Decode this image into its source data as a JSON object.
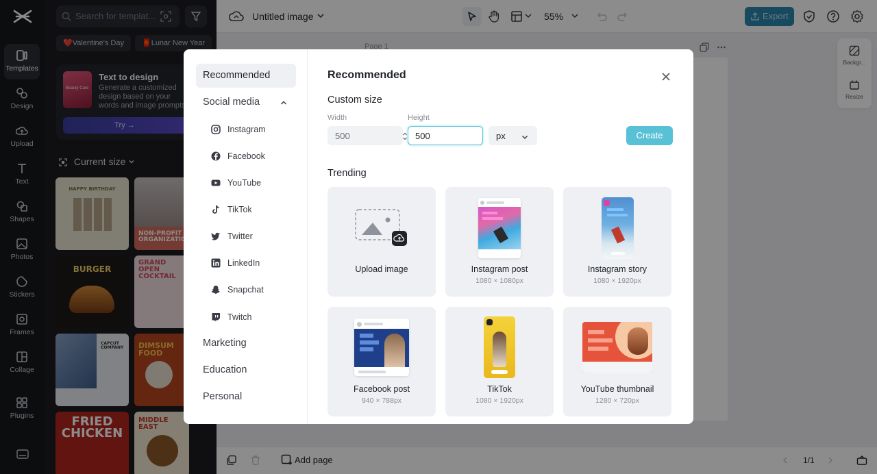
{
  "rail": {
    "items": [
      {
        "label": "Templates"
      },
      {
        "label": "Design"
      },
      {
        "label": "Upload"
      },
      {
        "label": "Text"
      },
      {
        "label": "Shapes"
      },
      {
        "label": "Photos"
      },
      {
        "label": "Stickers"
      },
      {
        "label": "Frames"
      },
      {
        "label": "Collage"
      },
      {
        "label": "Plugins"
      }
    ]
  },
  "panel": {
    "search_placeholder": "Search for templat...",
    "chips": [
      "❤️Valentine's Day",
      "🧧Lunar New Year"
    ],
    "text_to_design": {
      "thumb_text": "Beauty Care",
      "title": "Text to design",
      "desc": "Generate a customized design based on your words and image prompts.",
      "try_label": "Try →"
    },
    "current_size": "Current size",
    "templates": [
      {
        "text": "HAPPY BIRTHDAY"
      },
      {
        "text": "NON-PROFIT ORGANIZATION"
      },
      {
        "text": "BURGER"
      },
      {
        "text": "GRAND OPEN COCKTAIL"
      },
      {
        "text": "CAPCUT COMPANY"
      },
      {
        "text": "DIMSUM FOOD"
      },
      {
        "text": "FRIED CHICKEN"
      },
      {
        "text": "MIDDLE EAST"
      }
    ]
  },
  "topbar": {
    "title": "Untitled image",
    "zoom": "55%",
    "export_label": "Export"
  },
  "canvas": {
    "page_label": "Page 1",
    "side_tools": [
      "Backgr...",
      "Resize"
    ]
  },
  "bottombar": {
    "add_page": "Add page",
    "pager": "1/1"
  },
  "modal": {
    "nav": {
      "recommended": "Recommended",
      "social_media": "Social media",
      "social_items": [
        "Instagram",
        "Facebook",
        "YouTube",
        "TikTok",
        "Twitter",
        "LinkedIn",
        "Snapchat",
        "Twitch"
      ],
      "marketing": "Marketing",
      "education": "Education",
      "personal": "Personal"
    },
    "title": "Recommended",
    "custom_size": "Custom size",
    "width_label": "Width",
    "width_value": "500",
    "height_label": "Height",
    "height_value": "500",
    "unit": "px",
    "create_label": "Create",
    "trending": "Trending",
    "cards": [
      {
        "title": "Upload image",
        "sub": ""
      },
      {
        "title": "Instagram post",
        "sub": "1080 × 1080px"
      },
      {
        "title": "Instagram story",
        "sub": "1080 × 1920px"
      },
      {
        "title": "Facebook post",
        "sub": "940 × 788px"
      },
      {
        "title": "TikTok",
        "sub": "1080 × 1920px"
      },
      {
        "title": "YouTube thumbnail",
        "sub": "1280 × 720px"
      }
    ]
  }
}
